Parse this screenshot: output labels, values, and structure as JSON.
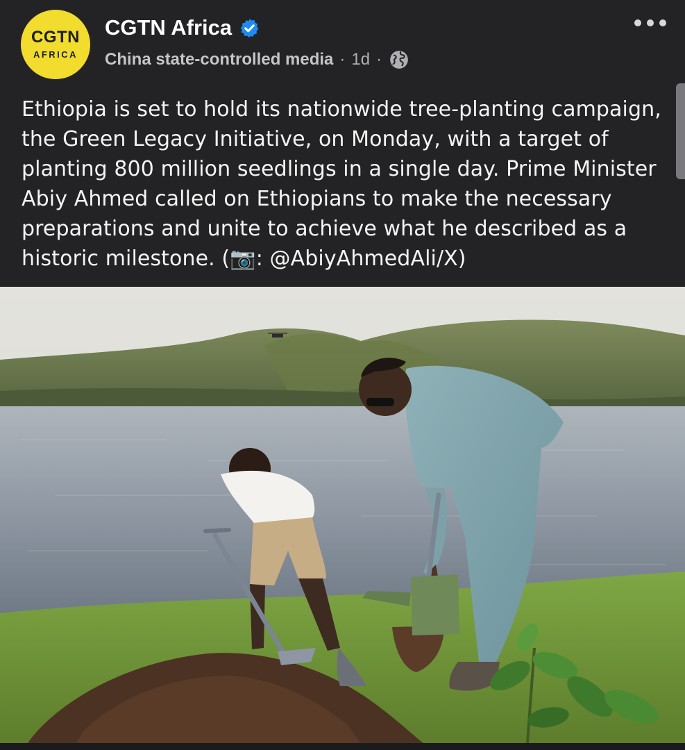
{
  "post": {
    "author": {
      "name": "CGTN Africa",
      "avatar_text": "CGTN",
      "avatar_subtext": "AFRICA",
      "verified": true,
      "label": "China state-controlled media"
    },
    "separator": "·",
    "timestamp": "1d",
    "visibility_icon": "globe-icon",
    "more_icon": "more-horizontal-icon",
    "text": "Ethiopia is set to hold its nationwide tree-planting campaign, the Green Legacy Initiative, on Monday, with a target of planting 800 million seedlings in a single day. Prime Minister Abiy Ahmed called on Ethiopians to make the necessary preparations and unite to achieve what he described as a historic milestone. (📷: @AbiyAhmedAli/X)"
  },
  "colors": {
    "background": "#232325",
    "avatar_bg": "#f2dd2e",
    "verified_badge": "#1d8cf0",
    "meta_text": "#b0b0b4"
  }
}
